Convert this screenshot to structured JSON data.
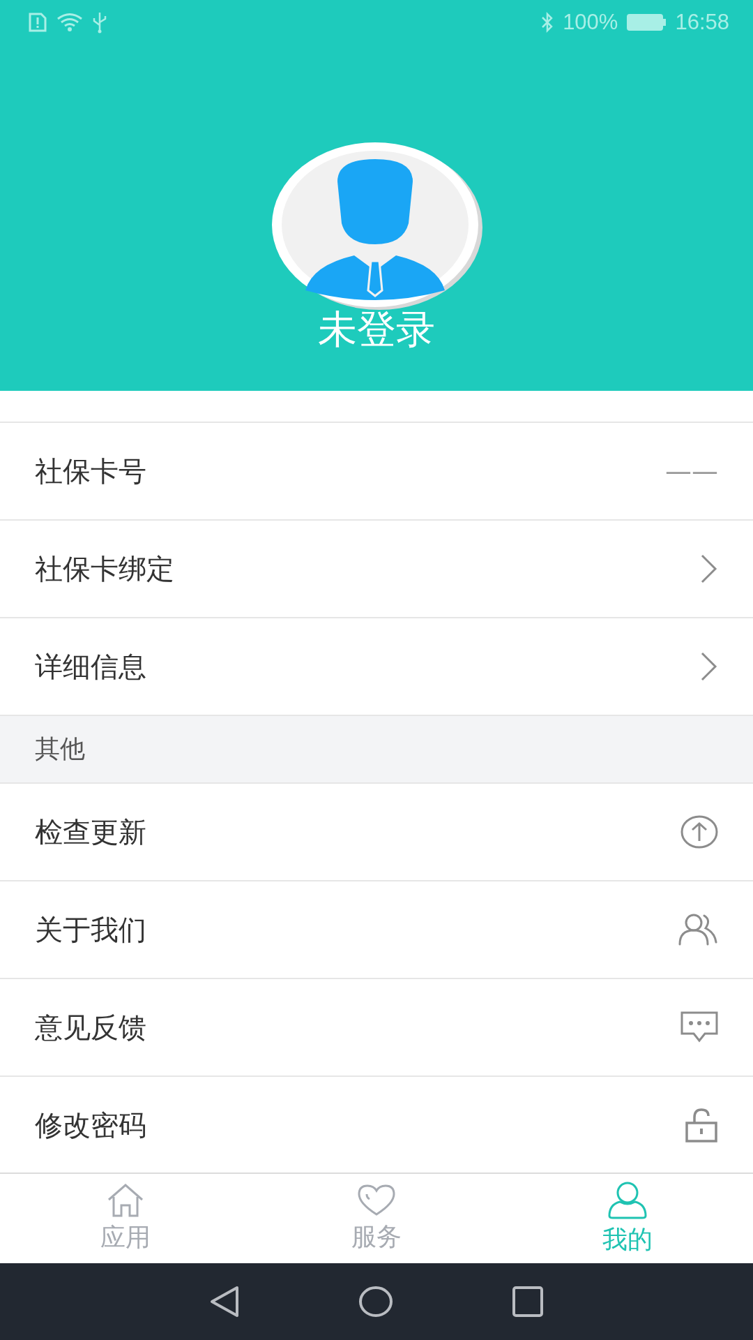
{
  "status_bar": {
    "battery": "100%",
    "time": "16:58"
  },
  "profile": {
    "name": "未登录"
  },
  "account_rows": [
    {
      "label": "社保卡号",
      "kind": "value",
      "value": "——"
    },
    {
      "label": "社保卡绑定",
      "kind": "arrow"
    },
    {
      "label": "详细信息",
      "kind": "arrow"
    }
  ],
  "section": {
    "title": "其他"
  },
  "other_rows": [
    {
      "label": "检查更新",
      "kind": "upload"
    },
    {
      "label": "关于我们",
      "kind": "people"
    },
    {
      "label": "意见反馈",
      "kind": "message"
    },
    {
      "label": "修改密码",
      "kind": "lock"
    }
  ],
  "tabs": [
    {
      "label": "应用",
      "kind": "home",
      "selected": false
    },
    {
      "label": "服务",
      "kind": "heart",
      "selected": false
    },
    {
      "label": "我的",
      "kind": "user",
      "selected": true
    }
  ]
}
